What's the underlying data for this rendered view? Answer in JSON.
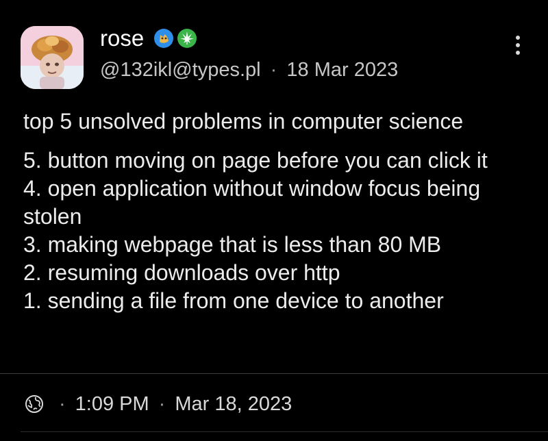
{
  "author": {
    "display_name": "rose",
    "handle": "@132ikl@types.pl",
    "avatar_icon": "profile-avatar",
    "badges": [
      "doge-badge-icon",
      "cannabis-leaf-badge-icon"
    ]
  },
  "post": {
    "date_short": "18 Mar 2023",
    "date_separator": "·",
    "intro": "top 5 unsolved problems in computer science",
    "items": [
      "5. button moving on page before you can click it",
      "4. open application without window focus being stolen",
      "3. making webpage that is less than 80 MB",
      "2. resuming downloads over http",
      "1. sending a file from one device to another"
    ]
  },
  "meta": {
    "visibility_icon": "globe-icon",
    "separator": "·",
    "time": "1:09 PM",
    "date": "Mar 18, 2023"
  },
  "colors": {
    "background": "#000000",
    "text": "#ececec",
    "muted": "#c7c7c7",
    "badge_blue": "#2f8fe8",
    "badge_green": "#3bb54a"
  }
}
